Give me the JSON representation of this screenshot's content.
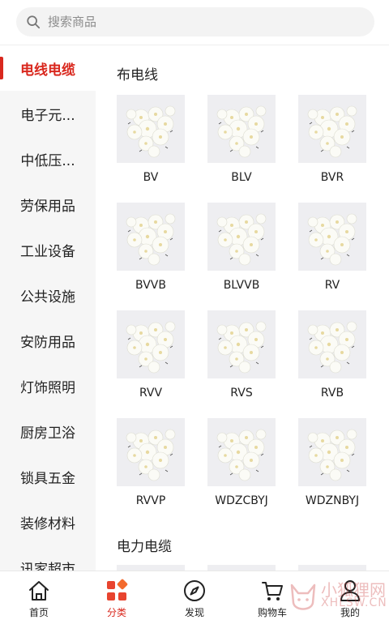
{
  "search": {
    "placeholder": "搜索商品",
    "icon": "search-icon"
  },
  "sidebar": {
    "items": [
      {
        "label": "电线电缆",
        "active": true
      },
      {
        "label": "电子元..."
      },
      {
        "label": "中低压..."
      },
      {
        "label": "劳保用品"
      },
      {
        "label": "工业设备"
      },
      {
        "label": "公共设施"
      },
      {
        "label": "安防用品"
      },
      {
        "label": "灯饰照明"
      },
      {
        "label": "厨房卫浴"
      },
      {
        "label": "锁具五金"
      },
      {
        "label": "装修材料"
      },
      {
        "label": "讯家超市"
      }
    ]
  },
  "content": {
    "sections": [
      {
        "title": "布电线",
        "products": [
          "BV",
          "BLV",
          "BVR",
          "BVVB",
          "BLVVB",
          "RV",
          "RVV",
          "RVS",
          "RVB",
          "RVVP",
          "WDZCBYJ",
          "WDZNBYJ"
        ]
      },
      {
        "title": "电力电缆",
        "products": []
      }
    ]
  },
  "tabbar": {
    "items": [
      {
        "label": "首页",
        "icon": "home-icon"
      },
      {
        "label": "分类",
        "icon": "category-icon",
        "active": true
      },
      {
        "label": "发现",
        "icon": "compass-icon"
      },
      {
        "label": "购物车",
        "icon": "cart-icon"
      },
      {
        "label": "我的",
        "icon": "user-icon"
      }
    ]
  },
  "colors": {
    "accent": "#d9281e",
    "sidebar_bg": "#f6f6f6"
  },
  "watermark": {
    "text": "小狐狸网",
    "sub": "XHLSW.CN"
  }
}
